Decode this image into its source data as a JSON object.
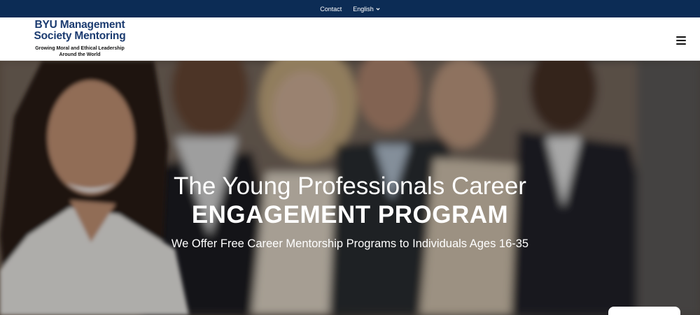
{
  "topbar": {
    "contact_label": "Contact",
    "language_label": "English",
    "language_icon": "chevron-down-icon",
    "background": "#0c2c55"
  },
  "header": {
    "logo_title_line1": "BYU Management",
    "logo_title_line2": "Society Mentoring",
    "logo_tagline_line1": "Growing Moral and Ethical Leadership",
    "logo_tagline_line2": "Around the World",
    "menu_icon": "hamburger-menu-icon",
    "brand_color": "#1b3b70"
  },
  "hero": {
    "title_line1": "The Young Professionals Career",
    "title_line2": "ENGAGEMENT PROGRAM",
    "subtitle": "We Offer Free Career Mentorship Programs to Individuals Ages 16-35"
  }
}
